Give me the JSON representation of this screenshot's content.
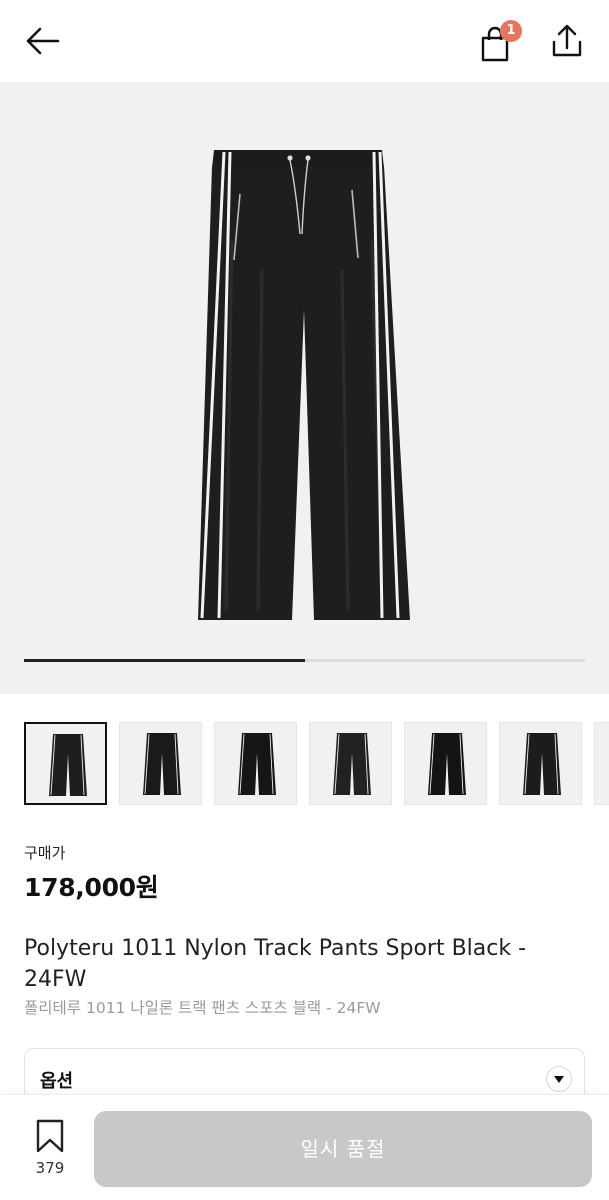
{
  "header": {
    "back_icon": "arrow-left-icon",
    "cart_icon": "shopping-bag-icon",
    "cart_count": "1",
    "share_icon": "share-upload-icon",
    "badge_color": "#e8735e"
  },
  "gallery": {
    "image": "black-nylon-track-pants-photo",
    "progress": 0.5,
    "thumbnail_count": 7,
    "selected_thumbnail": 1
  },
  "product": {
    "price_label": "구매가",
    "price": "178,000원",
    "title": "Polyteru 1011 Nylon Track Pants Sport Black - 24FW",
    "subtitle": "폴리테루 1011 나일론 트랙 팬츠 스포츠 블랙 - 24FW"
  },
  "options": {
    "label": "옵션",
    "chevron_icon": "chevron-down-icon"
  },
  "footer": {
    "bookmark_icon": "bookmark-icon",
    "bookmark_count": "379",
    "buy_button": "일시 품절",
    "buy_button_color": "#c8c8c8"
  }
}
